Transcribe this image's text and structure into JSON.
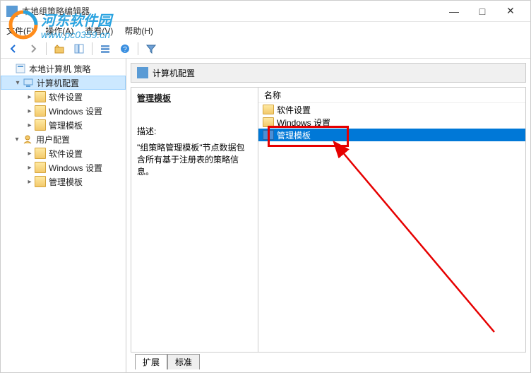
{
  "window": {
    "title": "本地组策略编辑器",
    "controls": {
      "min": "—",
      "max": "□",
      "close": "✕"
    }
  },
  "menubar": {
    "file": "文件(F)",
    "action": "操作(A)",
    "view": "查看(V)",
    "help": "帮助(H)"
  },
  "tree": {
    "root": "本地计算机 策略",
    "computer": "计算机配置",
    "comp_children": {
      "soft": "软件设置",
      "win": "Windows 设置",
      "admin": "管理模板"
    },
    "user": "用户配置",
    "user_children": {
      "soft": "软件设置",
      "win": "Windows 设置",
      "admin": "管理模板"
    }
  },
  "header": {
    "title": "计算机配置"
  },
  "left_panel": {
    "section_title": "管理模板",
    "desc_label": "描述:",
    "desc_text": "\"组策略管理模板\"节点数据包含所有基于注册表的策略信息。"
  },
  "right_panel": {
    "column_header": "名称",
    "items": [
      {
        "label": "软件设置"
      },
      {
        "label": "Windows 设置"
      },
      {
        "label": "管理模板",
        "selected": true
      }
    ]
  },
  "tabs": {
    "extended": "扩展",
    "standard": "标准"
  },
  "watermark": {
    "name": "河东软件园",
    "url": "www.pc0359.cn"
  }
}
